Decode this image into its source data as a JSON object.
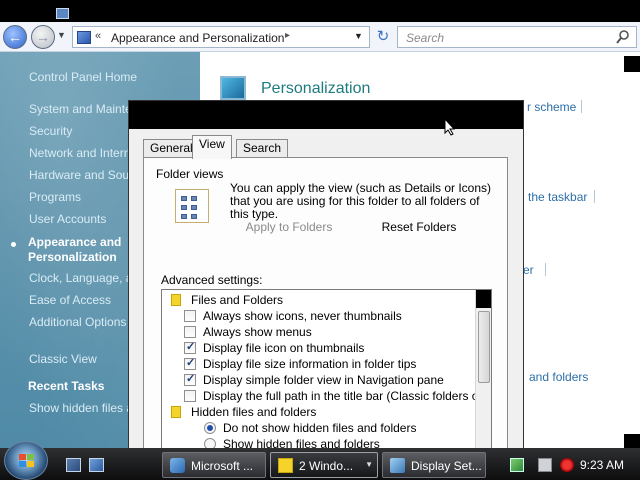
{
  "explorer": {
    "address": {
      "chevron": "«",
      "path_label": "Appearance and Personalization",
      "path_arrow": "▸"
    },
    "search": {
      "placeholder": "Search"
    },
    "left_pane": {
      "links": [
        "Control Panel Home",
        "System and Mainte",
        "Security",
        "Network and Intern",
        "Hardware and Sou",
        "Programs",
        "User Accounts"
      ],
      "active_line1": "Appearance and",
      "active_line2": "Personalization",
      "links_after": [
        "Clock, Language, a",
        "Ease of Access",
        "Additional Options"
      ],
      "classic_view": "Classic View",
      "recent_tasks_heading": "Recent Tasks",
      "recent_task": "Show hidden files a"
    },
    "main": {
      "personalization_title": "Personalization",
      "link_fragments": [
        "r scheme",
        "the taskbar",
        "er",
        "and folders"
      ]
    }
  },
  "dialog": {
    "tabs": [
      "General",
      "View",
      "Search"
    ],
    "active_tab": "View",
    "folder_views": {
      "label": "Folder views",
      "description": "You can apply the view (such as Details or Icons) that you are using for this folder to all folders of this type.",
      "apply_button": "Apply to Folders",
      "reset_button": "Reset Folders"
    },
    "advanced": {
      "label": "Advanced settings:",
      "rows": [
        {
          "type": "folder",
          "text": "Files and Folders"
        },
        {
          "type": "checkbox",
          "checked": false,
          "text": "Always show icons, never thumbnails"
        },
        {
          "type": "checkbox",
          "checked": false,
          "text": "Always show menus"
        },
        {
          "type": "checkbox",
          "checked": true,
          "text": "Display file icon on thumbnails"
        },
        {
          "type": "checkbox",
          "checked": true,
          "text": "Display file size information in folder tips"
        },
        {
          "type": "checkbox",
          "checked": true,
          "text": "Display simple folder view in Navigation pane"
        },
        {
          "type": "checkbox",
          "checked": false,
          "text": "Display the full path in the title bar (Classic folders only)"
        },
        {
          "type": "folder",
          "text": "Hidden files and folders"
        },
        {
          "type": "radio",
          "checked": true,
          "text": "Do not show hidden files and folders"
        },
        {
          "type": "radio",
          "checked": false,
          "text": "Show hidden files and folders"
        }
      ]
    }
  },
  "taskbar": {
    "buttons": [
      {
        "label": "Microsoft ...",
        "active": false,
        "arrow": ""
      },
      {
        "label": "2 Windo...",
        "active": true,
        "arrow": "▼"
      },
      {
        "label": "Display Set...",
        "active": false,
        "arrow": ""
      }
    ],
    "clock": "9:23 AM"
  },
  "colors": {
    "link": "#2c6fa9",
    "title_teal": "#1e7b7f",
    "left_pane": "#5f94ad",
    "checkmark": "#1d3d7a"
  },
  "icons": [
    "back-arrow-icon",
    "forward-arrow-icon",
    "control-panel-icon",
    "refresh-icon",
    "search-icon",
    "personalization-icon",
    "folder-views-icon",
    "folder-icon",
    "windows-start-icon",
    "mouse-cursor-icon"
  ]
}
